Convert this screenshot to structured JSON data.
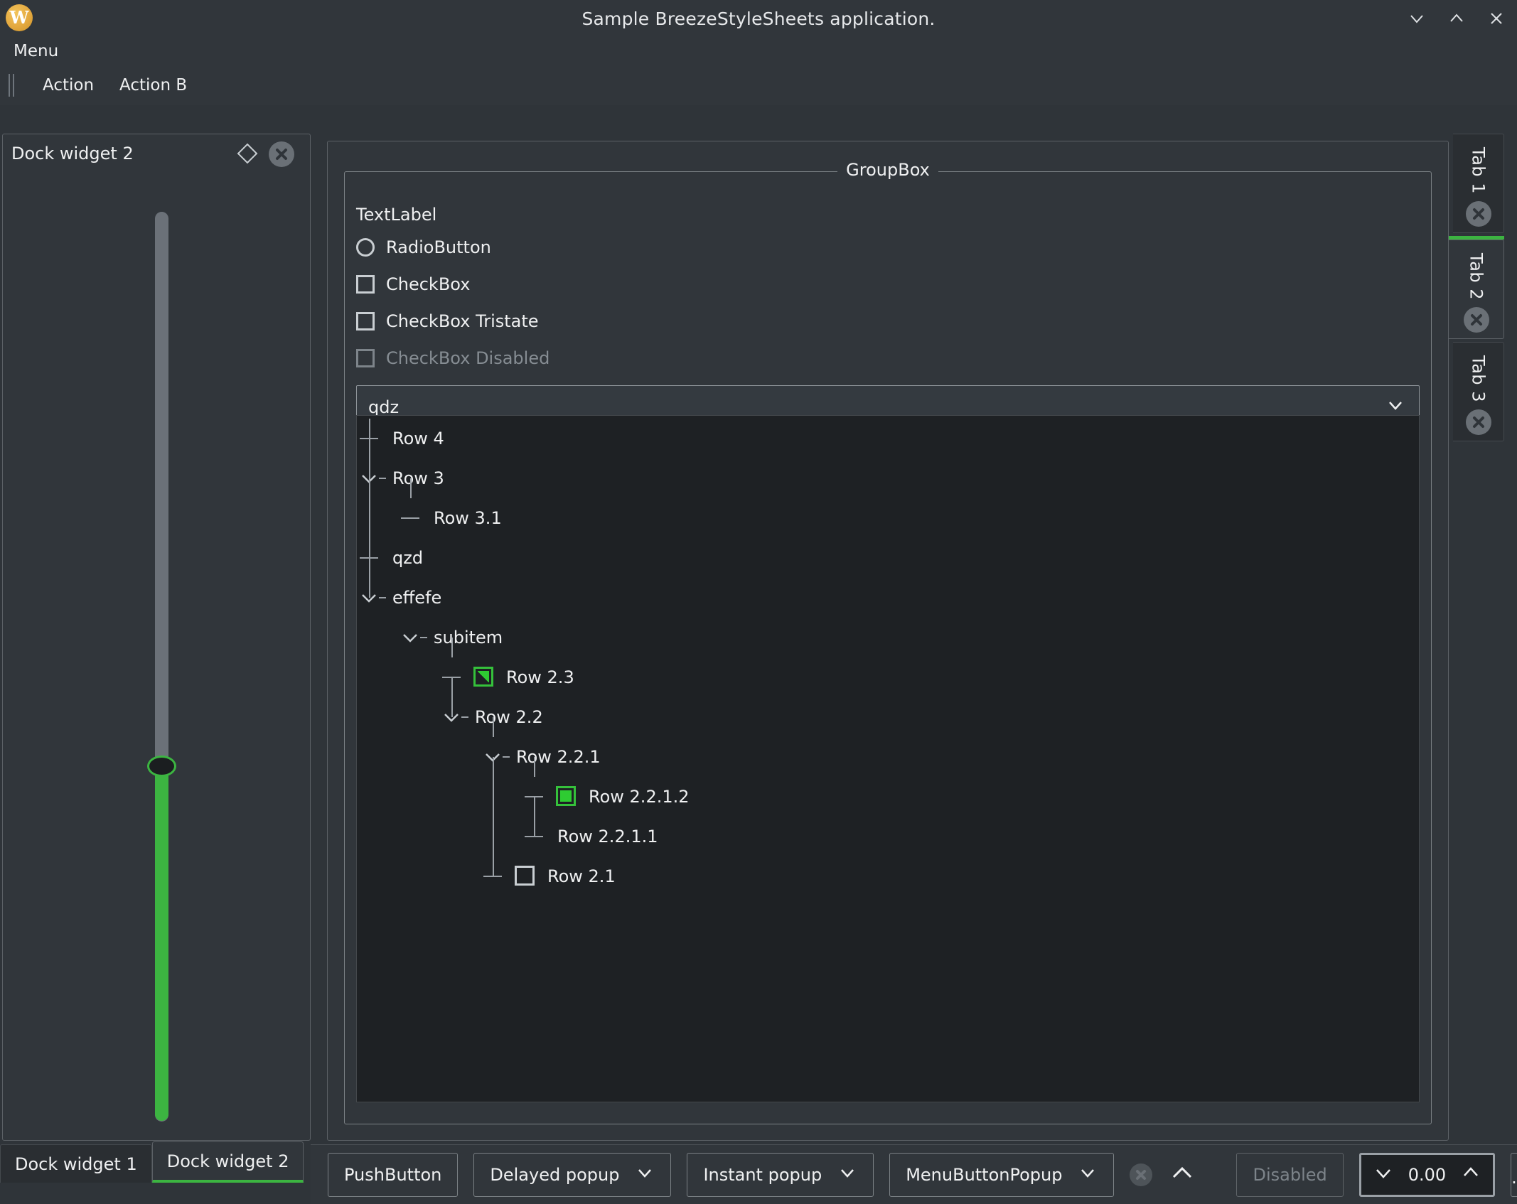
{
  "window": {
    "title": "Sample BreezeStyleSheets application.",
    "logo_glyph": "W",
    "controls": [
      {
        "name": "minimize-button",
        "glyph": "v"
      },
      {
        "name": "maximize-button",
        "glyph": "^"
      },
      {
        "name": "close-button",
        "glyph": "X"
      }
    ]
  },
  "menubar": {
    "items": [
      "Menu"
    ]
  },
  "toolbar": {
    "actions": [
      "Action",
      "Action B"
    ]
  },
  "dock": {
    "title": "Dock widget 2",
    "float_icon": "float-diamond-icon",
    "close_icon": "close-circle-icon",
    "slider": {
      "orientation": "vertical",
      "value_fraction": 0.37
    },
    "tabs": [
      {
        "label": "Dock widget 1",
        "active": false
      },
      {
        "label": "Dock widget 2",
        "active": true
      }
    ]
  },
  "tabwidget": {
    "tabs": [
      {
        "label": "Tab 1",
        "active": false
      },
      {
        "label": "Tab 2",
        "active": true
      },
      {
        "label": "Tab 3",
        "active": false
      }
    ],
    "close_icon": "close-circle-icon"
  },
  "groupbox": {
    "title": "GroupBox",
    "textlabel": "TextLabel",
    "radio": {
      "label": "RadioButton",
      "checked": false
    },
    "checkboxes": [
      {
        "label": "CheckBox",
        "checked": false,
        "disabled": false
      },
      {
        "label": "CheckBox Tristate",
        "checked": false,
        "disabled": false
      },
      {
        "label": "CheckBox Disabled",
        "checked": false,
        "disabled": true
      }
    ],
    "combobox": {
      "value": "qdz",
      "arrow_icon": "chevron-down-icon"
    }
  },
  "tree": {
    "nodes": [
      {
        "label": "Row 4",
        "depth": 0,
        "expander": "none",
        "check": "none"
      },
      {
        "label": "Row 3",
        "depth": 0,
        "expander": "expanded",
        "check": "none"
      },
      {
        "label": "Row 3.1",
        "depth": 1,
        "expander": "none",
        "check": "none"
      },
      {
        "label": "qzd",
        "depth": 0,
        "expander": "none",
        "check": "none"
      },
      {
        "label": "effefe",
        "depth": 0,
        "expander": "expanded",
        "check": "none"
      },
      {
        "label": "subitem",
        "depth": 1,
        "expander": "expanded",
        "check": "none"
      },
      {
        "label": "Row 2.3",
        "depth": 2,
        "expander": "none",
        "check": "partial"
      },
      {
        "label": "Row 2.2",
        "depth": 2,
        "expander": "expanded",
        "check": "none"
      },
      {
        "label": "Row 2.2.1",
        "depth": 3,
        "expander": "expanded",
        "check": "none"
      },
      {
        "label": "Row 2.2.1.2",
        "depth": 4,
        "expander": "none",
        "check": "checked"
      },
      {
        "label": "Row 2.2.1.1",
        "depth": 4,
        "expander": "none",
        "check": "none"
      },
      {
        "label": "Row 2.1",
        "depth": 3,
        "expander": "none",
        "check": "unchecked"
      }
    ]
  },
  "buttonbar": {
    "pushbutton": "PushButton",
    "delayed_popup": "Delayed popup",
    "instant_popup": "Instant popup",
    "menubutton_popup": "MenuButtonPopup",
    "clear_icon": "close-circle-icon",
    "up_icon": "chevron-up-icon",
    "disabled_button": "Disabled",
    "spinbox": {
      "value": "0.00",
      "down_icon": "chevron-down-icon",
      "up_icon": "chevron-up-icon"
    },
    "dots_button": "..."
  },
  "colors": {
    "window_bg": "#31363b",
    "base_bg": "#1e2124",
    "text": "#eff0f1",
    "disabled_text": "#868d93",
    "border": "#7b8185",
    "accent_green": "#3cb441",
    "logo_orange": "#e4a940"
  }
}
